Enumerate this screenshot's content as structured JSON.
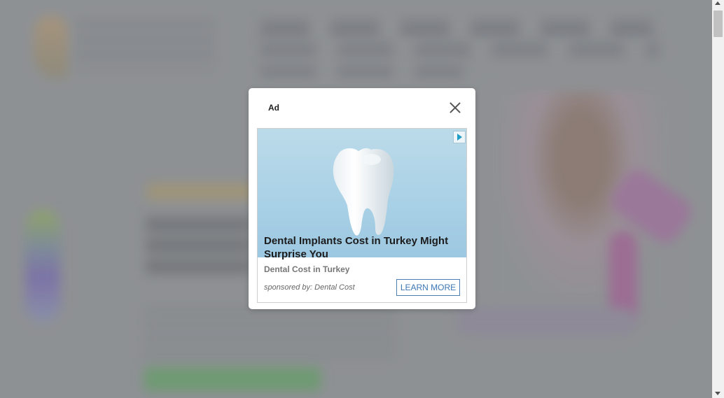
{
  "modal": {
    "ad_label": "Ad",
    "title": "Dental Implants Cost in Turkey Might Surprise You",
    "source": "Dental Cost in Turkey",
    "sponsored": "sponsored by: Dental Cost",
    "cta": "LEARN MORE",
    "close_icon": "close-icon",
    "adchoices_icon": "adchoices-icon"
  },
  "colors": {
    "overlay": "#8e9194",
    "cta_border": "#4a7fb5",
    "ad_image_bg": "#a8d0e6"
  }
}
